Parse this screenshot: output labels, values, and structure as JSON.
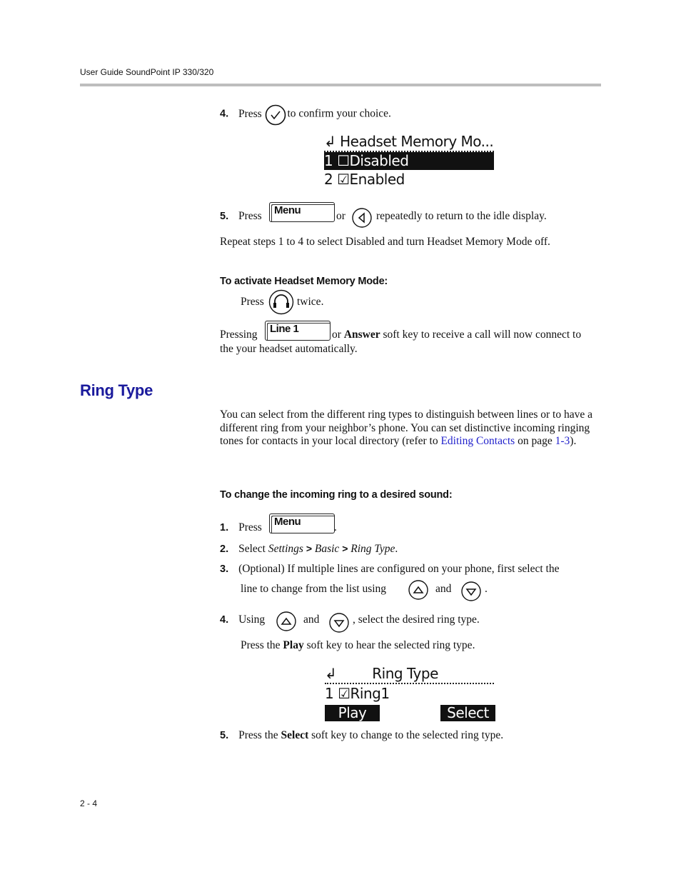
{
  "header": {
    "title": "User Guide SoundPoint IP 330/320"
  },
  "section1": {
    "step4": {
      "num": "4.",
      "press": "Press",
      "rest": "to confirm your choice.",
      "icon": "check-circle-icon"
    },
    "lcd1": {
      "title": "Headset Memory Mo...",
      "rows": [
        {
          "num": "1",
          "box": "☐",
          "label": "Disabled",
          "selected": true
        },
        {
          "num": "2",
          "box": "☑",
          "label": "Enabled",
          "selected": false
        }
      ]
    },
    "step5": {
      "num": "5.",
      "press": "Press",
      "key": "Menu",
      "or": "or",
      "rest": "repeatedly to return to the idle display.",
      "icon": "left-arrow-circle-icon"
    },
    "repeat": "Repeat steps 1 to 4 to select Disabled and turn Headset Memory Mode off."
  },
  "activate": {
    "heading": "To activate Headset Memory Mode:",
    "press": "Press",
    "twice": "twice.",
    "icon": "headset-icon",
    "pressing": "Pressing",
    "key": "Line 1",
    "or": "or",
    "answer": "Answer",
    "rest1": "soft key to receive a call will now connect to",
    "rest2": "the your headset automatically."
  },
  "ring_type": {
    "title": "Ring Type",
    "intro": {
      "t1": "You can select from the different ring types to distinguish between lines or to have a different ring from your neighbor’s phone. You can set distinctive incoming ringing tones for contacts in your local directory (refer to ",
      "link": "Editing Contacts",
      "t2": " on page ",
      "page_link": "1-3",
      "t3": ")."
    },
    "subheading": "To change the incoming ring to a desired sound:",
    "steps": {
      "s1": {
        "num": "1.",
        "press": "Press",
        "key": "Menu",
        "end": "."
      },
      "s2": {
        "num": "2.",
        "select": "Select",
        "settings": "Settings",
        "gt1": ">",
        "basic": "Basic",
        "gt2": ">",
        "ringtype": "Ring Type",
        "end": "."
      },
      "s3": {
        "num": "3.",
        "line1": "(Optional) If multiple lines are configured on your phone, first select the",
        "line2": "line to change from the list using",
        "and": "and",
        "end": "."
      },
      "s4": {
        "num": "4.",
        "using": "Using",
        "and": "and",
        "rest": ", select the desired ring type.",
        "p1": "Press the",
        "play": "Play",
        "p2": "soft key to hear the selected ring type."
      },
      "s5": {
        "num": "5.",
        "p1": "Press the",
        "select": "Select",
        "p2": "soft key to change to the selected ring type."
      }
    },
    "lcd2": {
      "title": "Ring Type",
      "row": {
        "num": "1",
        "box": "☑",
        "label": "Ring1"
      },
      "softkeys": [
        "Play",
        "Select"
      ]
    }
  },
  "footer": {
    "page": "2 - 4"
  }
}
